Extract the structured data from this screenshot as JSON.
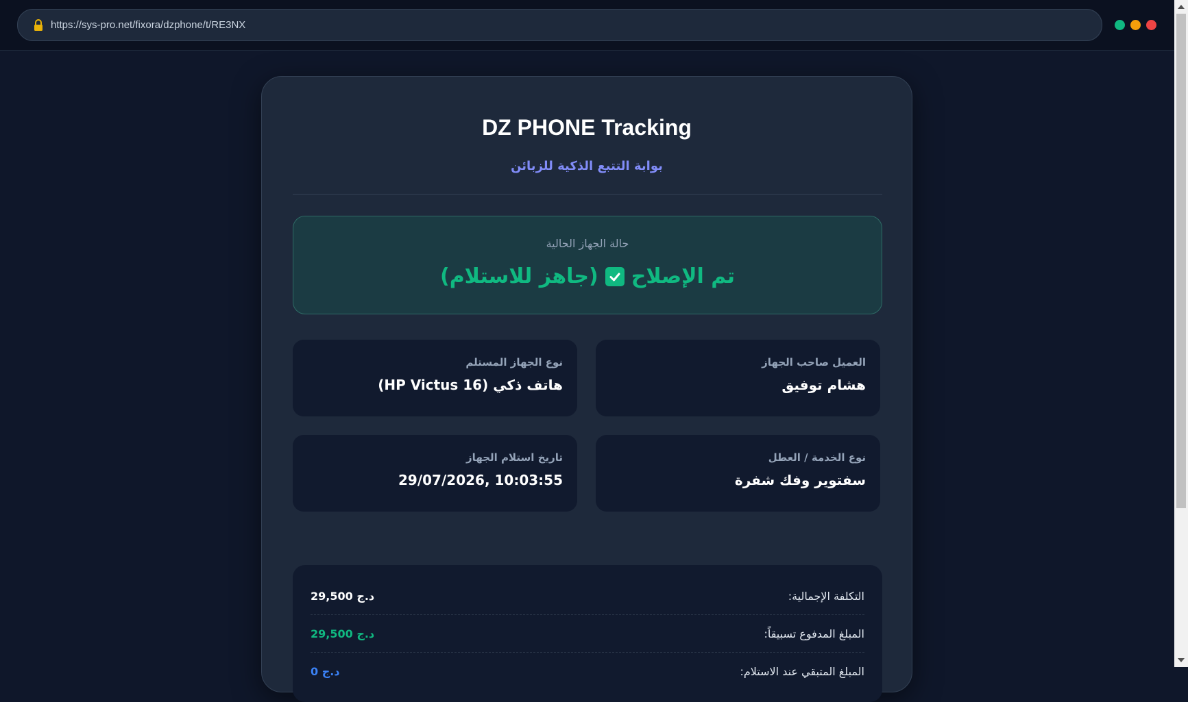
{
  "browser": {
    "url": "https://sys-pro.net/fixora/dzphone/t/RE3NX",
    "window_dots": [
      "#10b981",
      "#f59e0b",
      "#ef4444"
    ]
  },
  "page": {
    "title": "DZ PHONE Tracking",
    "subtitle": "بوابة التتبع الذكية للزبائن"
  },
  "status": {
    "label": "حالة الجهاز الحالية",
    "value_main": "تم الإصلاح",
    "value_note": "(جاهز للاستلام)",
    "color": "#10b981"
  },
  "info": {
    "client_label": "العميل صاحب الجهاز",
    "client_value": "هشام توفيق",
    "device_label": "نوع الجهاز المستلم",
    "device_value": "هاتف ذكي (HP Victus 16)",
    "service_label": "نوع الخدمة / العطل",
    "service_value": "سفتوير وفك شفرة",
    "date_label": "تاريخ استلام الجهاز",
    "date_value": "29/07/2026, 10:03:55"
  },
  "costs": {
    "total_label": "التكلفة الإجمالية:",
    "total_value": "29,500 د.ج",
    "paid_label": "المبلغ المدفوع تسبيقاً:",
    "paid_value": "29,500 د.ج",
    "remaining_label": "المبلغ المتبقي عند الاستلام:",
    "remaining_value": "0 د.ج",
    "colors": {
      "total": "#ffffff",
      "paid": "#10b981",
      "remaining": "#3b82f6"
    }
  }
}
